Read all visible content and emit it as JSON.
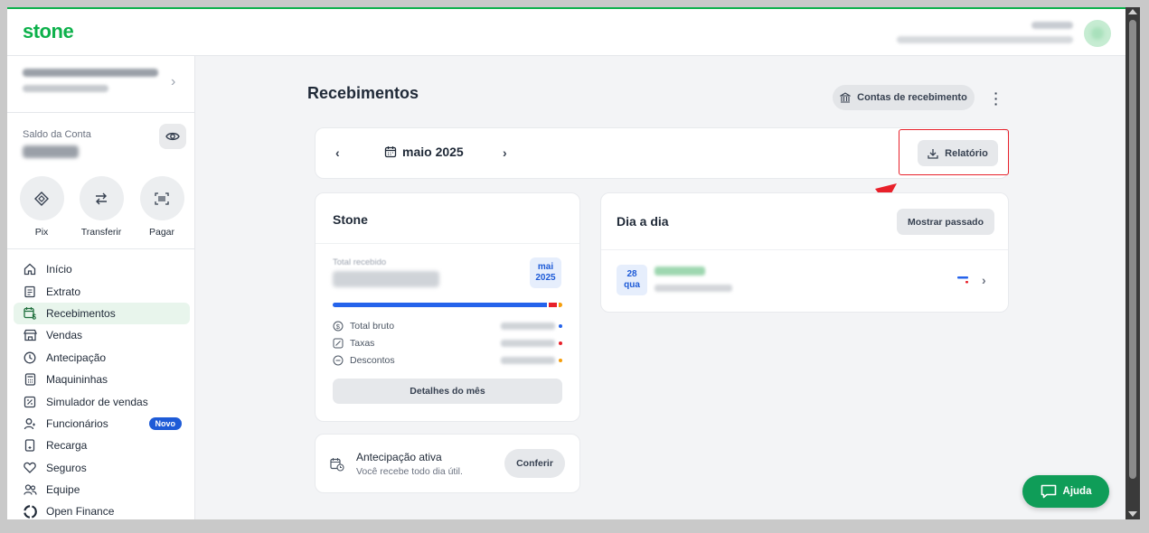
{
  "header": {
    "logo": "stone",
    "brand_color": "#0db14b"
  },
  "sidebar": {
    "saldo_label": "Saldo da Conta",
    "quick_actions": [
      {
        "label": "Pix",
        "icon": "pix-icon"
      },
      {
        "label": "Transferir",
        "icon": "transfer-icon"
      },
      {
        "label": "Pagar",
        "icon": "barcode-icon"
      }
    ],
    "nav": [
      {
        "label": "Início",
        "icon": "home-icon"
      },
      {
        "label": "Extrato",
        "icon": "receipt-icon"
      },
      {
        "label": "Recebimentos",
        "icon": "calendar-money-icon",
        "active": true
      },
      {
        "label": "Vendas",
        "icon": "store-icon"
      },
      {
        "label": "Antecipação",
        "icon": "clock-icon"
      },
      {
        "label": "Maquininhas",
        "icon": "card-machine-icon"
      },
      {
        "label": "Simulador de vendas",
        "icon": "calculator-icon"
      },
      {
        "label": "Funcionários",
        "icon": "people-icon",
        "badge": "Novo"
      },
      {
        "label": "Recarga",
        "icon": "phone-icon"
      },
      {
        "label": "Seguros",
        "icon": "heart-icon"
      },
      {
        "label": "Equipe",
        "icon": "team-icon"
      },
      {
        "label": "Open Finance",
        "icon": "open-finance-icon"
      }
    ]
  },
  "main": {
    "title": "Recebimentos",
    "contas_button": "Contas de recebimento",
    "month_label": "maio 2025",
    "relatorio_button": "Relatório",
    "stone_card": {
      "title": "Stone",
      "total_label": "Total recebido",
      "period_month": "mai",
      "period_year": "2025",
      "legend": [
        {
          "label": "Total bruto",
          "color": "#2563eb"
        },
        {
          "label": "Taxas",
          "color": "#e8202a"
        },
        {
          "label": "Descontos",
          "color": "#f59e0b"
        }
      ],
      "details_button": "Detalhes do mês"
    },
    "antecipacao": {
      "title": "Antecipação ativa",
      "subtitle": "Você recebe todo dia útil.",
      "button": "Conferir"
    },
    "dia_a_dia": {
      "title": "Dia a dia",
      "button": "Mostrar passado",
      "entries": [
        {
          "day": "28",
          "weekday": "qua"
        }
      ]
    }
  },
  "help_button": "Ajuda",
  "highlight_color": "#e8202a"
}
